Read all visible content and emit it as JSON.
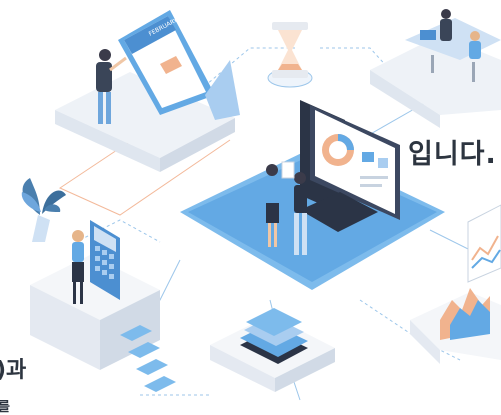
{
  "text": {
    "line1": "입니다.",
    "line2": ")과",
    "line3": "를"
  },
  "calendar": {
    "header": "FEBRUARY"
  },
  "colors": {
    "accent": "#63a9e4",
    "platform_top": "#f4f6f9",
    "platform_side": "#e4e9f1",
    "connector": "#9cc6ea",
    "screen_frame": "#2b3446",
    "text": "#2d3540",
    "hourglass_sand": "#f1b38e"
  },
  "icons": [
    "calendar-icon",
    "hourglass-icon",
    "meeting-desk-icon",
    "plant-icon",
    "computer-monitor-icon",
    "calculator-icon",
    "books-icon",
    "growth-chart-icon"
  ]
}
